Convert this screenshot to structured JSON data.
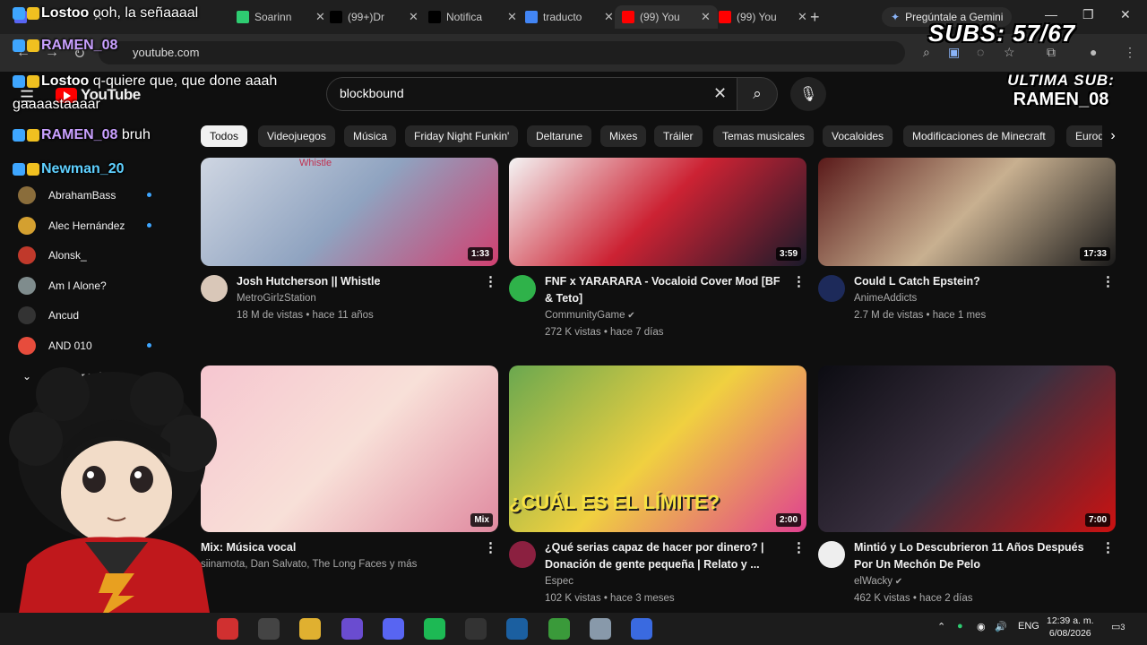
{
  "browser": {
    "tabs": [
      {
        "title": "",
        "favicon": "discord-icon",
        "color": "#5865f2"
      },
      {
        "title": "Soarinn",
        "favicon": "shop-icon",
        "color": "#2ecc71"
      },
      {
        "title": "(99+)Dr",
        "favicon": "tiktok-icon",
        "color": "#000000"
      },
      {
        "title": "Notifica",
        "favicon": "x-icon",
        "color": "#000000"
      },
      {
        "title": "traducto",
        "favicon": "google-icon",
        "color": "#4285f4"
      },
      {
        "title": "(99) You",
        "favicon": "youtube-icon",
        "color": "#ff0000"
      },
      {
        "title": "(99) You",
        "favicon": "youtube-icon",
        "color": "#ff0000"
      }
    ],
    "gemini_label": "Pregúntale a Gemini",
    "url": "youtube.com"
  },
  "youtube": {
    "logo_text": "YouTube",
    "search_query": "blockbound",
    "chips": [
      "Todos",
      "Videojuegos",
      "Música",
      "Friday Night Funkin'",
      "Deltarune",
      "Mixes",
      "Tráiler",
      "Temas musicales",
      "Vocaloides",
      "Modificaciones de Minecraft",
      "Eurod"
    ],
    "sidebar": {
      "subscriptions": [
        {
          "name": "AbrahamBass",
          "color": "#8a6d3b",
          "new": true
        },
        {
          "name": "Alec Hernández",
          "color": "#d4a030",
          "new": true
        },
        {
          "name": "Alonsk_",
          "color": "#c0392b",
          "new": false
        },
        {
          "name": "Am I Alone?",
          "color": "#7f8c8d",
          "new": false
        },
        {
          "name": "Ancud",
          "color": "#333333",
          "new": false
        },
        {
          "name": "AND 010",
          "color": "#e74c3c",
          "new": true
        }
      ],
      "show_more": "Mostrar más"
    },
    "videos": [
      {
        "title_lines": [
          "Josh Hutcherson || Whistle"
        ],
        "channel": "MetroGirlzStation",
        "meta": "18 M de vistas • hace 11 años",
        "duration": "1:33",
        "thumb_colors": [
          "#cfd6e2",
          "#8fa3c0",
          "#d04070"
        ],
        "avatar_color": "#d9c7b8",
        "verified": false
      },
      {
        "title_lines": [
          "FNF x YARARARA - Vocaloid Cover Mod [BF",
          "& Teto]"
        ],
        "channel": "CommunityGame",
        "meta": "272 K vistas • hace 7 días",
        "duration": "3:59",
        "thumb_colors": [
          "#f4f4f4",
          "#cc2233",
          "#1a1a2a"
        ],
        "avatar_color": "#2fb24a",
        "verified": true
      },
      {
        "title_lines": [
          "Could L Catch Epstein?"
        ],
        "channel": "AnimeAddicts",
        "meta": "2.7 M de vistas • hace 1 mes",
        "duration": "17:33",
        "thumb_colors": [
          "#5a1a1a",
          "#c8b090",
          "#1a1a1a"
        ],
        "avatar_color": "#1d2a5a",
        "verified": false
      },
      {
        "title_lines": [
          "Mix: Música vocal"
        ],
        "channel": "siinamota, Dan Salvato, The Long Faces y más",
        "meta": "",
        "duration": "Mix",
        "thumb_colors": [
          "#f6c6d0",
          "#f8e0d8",
          "#e08aa0"
        ],
        "avatar_color": "",
        "verified": false
      },
      {
        "title_lines": [
          "¿Qué serias capaz de hacer por dinero? |",
          "Donación de gente pequeña | Relato y ..."
        ],
        "channel": "Espec",
        "meta": "102 K vistas • hace 3 meses",
        "duration": "2:00",
        "thumb_colors": [
          "#6aa84f",
          "#f0d040",
          "#e04090"
        ],
        "avatar_color": "#8b2040",
        "verified": false
      },
      {
        "title_lines": [
          "Mintió y Lo Descubrieron 11 Años Después",
          "Por Un Mechón De Pelo"
        ],
        "channel": "elWacky",
        "meta": "462 K vistas • hace 2 días",
        "duration": "7:00",
        "thumb_colors": [
          "#0c0c12",
          "#3a3040",
          "#cc1111"
        ],
        "avatar_color": "#eeeeee",
        "verified": true
      }
    ],
    "thumb_texts": {
      "whistle": "Whistle",
      "limit": "¿CUÁL ES EL LÍMITE?"
    }
  },
  "overlay": {
    "chat": [
      {
        "user": "Lostoo",
        "text": "ooh, la señaaaal",
        "color": "#ffffff"
      },
      {
        "user": "RAMEN_08",
        "text": "",
        "color": "#c9a0ff"
      },
      {
        "user": "Lostoo",
        "text": "q-quiere que, que done aaah",
        "color": "#ffffff"
      },
      {
        "user": "",
        "text": "gaaaastaaaar",
        "color": "#ffffff"
      },
      {
        "user": "RAMEN_08",
        "text": "bruh",
        "color": "#c9a0ff"
      },
      {
        "user": "Newman_20",
        "text": "",
        "color": "#5fd0ff"
      }
    ],
    "subs_label": "SUBS: 57/67",
    "last_sub_label": "ULTIMA SUB:",
    "last_sub_name": "RAMEN_08"
  },
  "taskbar": {
    "apps": [
      "valorant-icon",
      "obs-icon",
      "file-explorer-icon",
      "xbox-icon",
      "discord-icon",
      "spotify-icon",
      "epic-games-icon",
      "steam-icon",
      "minecraft-icon",
      "notepad-icon",
      "roblox-icon"
    ],
    "lang": "ENG",
    "time": "12:39 a. m.",
    "date": "6/08/2026",
    "notifications": "3"
  }
}
